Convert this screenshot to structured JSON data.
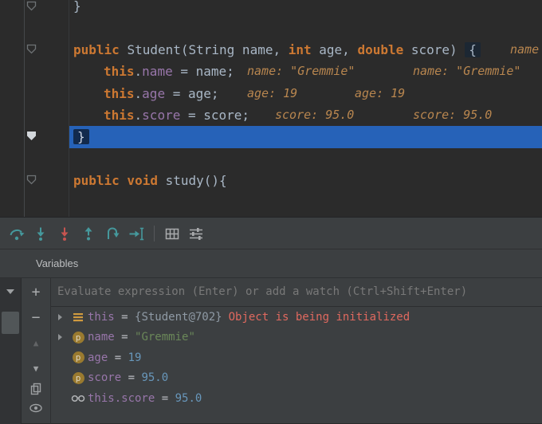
{
  "editor": {
    "line1": {
      "text": "}"
    },
    "line2": {
      "kw1": "public ",
      "sig1": "Student(String name, ",
      "kw2": "int",
      "sig2": " age, ",
      "kw3": "double",
      "sig3": " score) ",
      "brace": "{",
      "hint_right": "name"
    },
    "line3": {
      "kw": "this",
      "dot": ".",
      "field": "name",
      "rest": " = name;",
      "hint1": "name: \"Gremmie\"",
      "hint2": "name: \"Gremmie\""
    },
    "line4": {
      "kw": "this",
      "dot": ".",
      "field": "age",
      "rest": " = age;",
      "hint1": "age: 19",
      "hint2": "age: 19"
    },
    "line5": {
      "kw": "this",
      "dot": ".",
      "field": "score",
      "rest": " = score;",
      "hint1": "score: 95.0",
      "hint2": "score: 95.0"
    },
    "line6": {
      "text": "}"
    },
    "line8": {
      "kw": "public void ",
      "rest": "study(){"
    }
  },
  "debug": {
    "toolbar_icons": [
      "step-over",
      "step-into",
      "force-step-into",
      "step-out",
      "drop-frame",
      "run-to-cursor",
      "restore-layout",
      "settings-filter"
    ],
    "tab": "Variables",
    "evaluate_placeholder": "Evaluate expression (Enter) or add a watch (Ctrl+Shift+Enter)",
    "watch_buttons": [
      "add-watch",
      "remove-watch",
      "move-up",
      "move-down",
      "duplicate",
      "show"
    ],
    "icons": {
      "parameter_glyph": "p",
      "add": "+",
      "remove": "−",
      "up": "▲",
      "down": "▼"
    },
    "variables": [
      {
        "name": "this",
        "eq": " = ",
        "value": "{Student@702}",
        "note": "Object is being initialized"
      },
      {
        "name": "name",
        "eq": " = ",
        "value": "\"Gremmie\""
      },
      {
        "name": "age",
        "eq": " = ",
        "value": "19"
      },
      {
        "name": "score",
        "eq": " = ",
        "value": "95.0"
      },
      {
        "name": "this.score",
        "eq": " = ",
        "value": "95.0"
      }
    ]
  },
  "colors": {
    "editor_bg": "#2b2b2b",
    "panel_bg": "#3c3f41",
    "execution_line": "#2662b8",
    "keyword": "#cc7832",
    "inline_hint": "#b8864f",
    "string": "#6a8759",
    "number": "#6897bb",
    "field": "#9876aa",
    "error_note": "#e0695f",
    "step_icon": "#45989c",
    "force_step_icon": "#c75450"
  }
}
